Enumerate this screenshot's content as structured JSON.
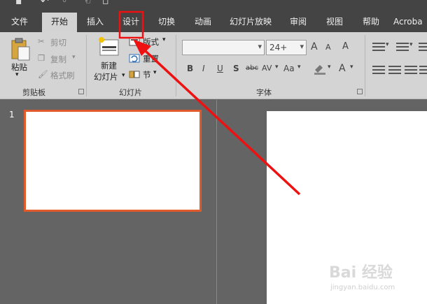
{
  "tabs": [
    {
      "label": "文件"
    },
    {
      "label": "开始"
    },
    {
      "label": "插入"
    },
    {
      "label": "设计"
    },
    {
      "label": "切换"
    },
    {
      "label": "动画"
    },
    {
      "label": "幻灯片放映"
    },
    {
      "label": "审阅"
    },
    {
      "label": "视图"
    },
    {
      "label": "帮助"
    },
    {
      "label": "Acroba"
    }
  ],
  "active_tab": "开始",
  "clipboard": {
    "paste": "粘贴",
    "cut": "剪切",
    "copy": "复制",
    "format_painter": "格式刷",
    "group_label": "剪贴板"
  },
  "slides_group": {
    "new_slide_line1": "新建",
    "new_slide_line2": "幻灯片",
    "layout": "版式",
    "reset": "重置",
    "section": "节",
    "group_label": "幻灯片"
  },
  "font_group": {
    "font_name": "",
    "font_size": "24+",
    "grow": "A",
    "shrink": "A",
    "clear": "A",
    "bold": "B",
    "italic": "I",
    "underline": "U",
    "shadow": "S",
    "strike": "abc",
    "spacing": "AV",
    "case": "Aa",
    "font_color": "A",
    "group_label": "字体"
  },
  "thumbnail": {
    "number": "1"
  },
  "watermark": {
    "brand": "Bai 经验",
    "url": "jingyan.baidu.com"
  },
  "colors": {
    "highlight": "#ee1111",
    "thumb_border": "#e05a2b"
  }
}
